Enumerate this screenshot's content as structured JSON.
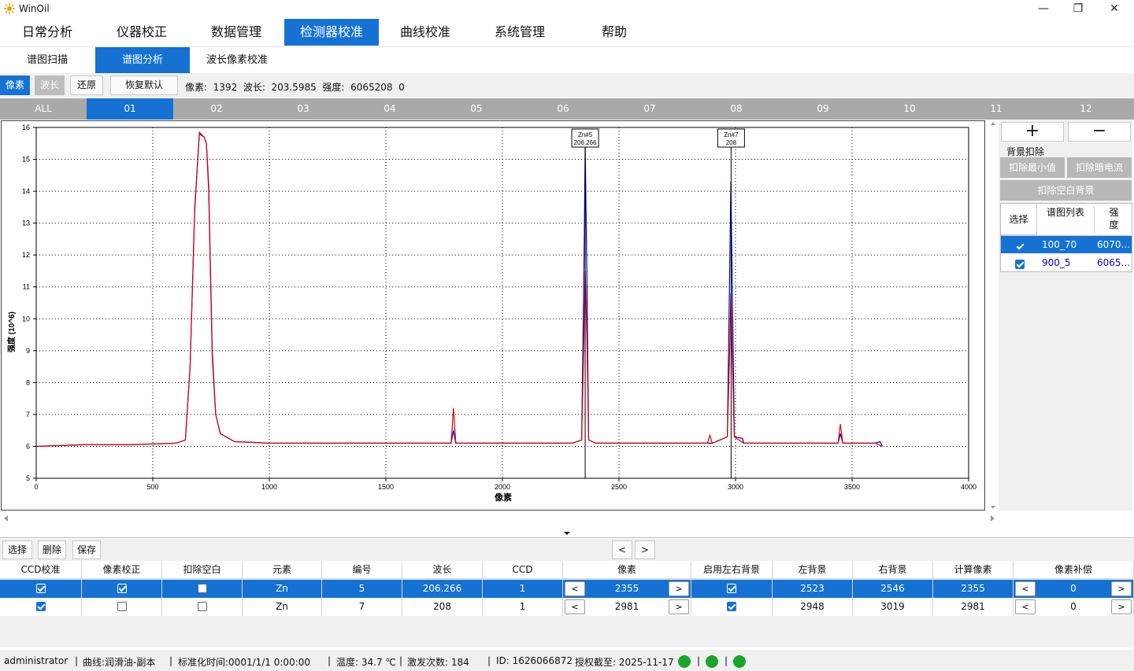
{
  "window": {
    "title": "WinOil",
    "min": "—",
    "max": "❐",
    "close": "✕"
  },
  "menu": {
    "tabs": [
      "日常分析",
      "仪器校正",
      "数据管理",
      "检测器校准",
      "曲线校准",
      "系统管理",
      "帮助"
    ],
    "active": 3
  },
  "submenu": {
    "tabs": [
      "谱图扫描",
      "谱图分析",
      "波长像素校准"
    ],
    "active": 1
  },
  "toolbar": {
    "pixel_toggle": "像素",
    "wavelength_toggle": "波长",
    "restore": "还原",
    "reset_default": "恢复默认",
    "readout": "像素:  1392  波长:  203.5985  强度:  6065208  0"
  },
  "channel_tabs": {
    "labels": [
      "ALL",
      "01",
      "02",
      "03",
      "04",
      "05",
      "06",
      "07",
      "08",
      "09",
      "10",
      "11",
      "12"
    ],
    "active": 1
  },
  "chart_data": {
    "type": "line",
    "xlabel": "像素",
    "ylabel": "强度 (10^6)",
    "xlim": [
      0,
      4000
    ],
    "ylim": [
      5,
      16
    ],
    "xticks": [
      0,
      500,
      1000,
      1500,
      2000,
      2500,
      3000,
      3500,
      4000
    ],
    "yticks": [
      5,
      6,
      7,
      8,
      9,
      10,
      11,
      12,
      13,
      14,
      15,
      16
    ],
    "grid": true,
    "markers": [
      {
        "label": "Zn#5",
        "value": "206.266",
        "x": 2355
      },
      {
        "label": "Zn#7",
        "value": "208",
        "x": 2981
      }
    ],
    "series": [
      {
        "color": "#0000cc",
        "points": [
          [
            0,
            6.0
          ],
          [
            200,
            6.05
          ],
          [
            400,
            6.05
          ],
          [
            600,
            6.1
          ],
          [
            640,
            6.2
          ],
          [
            660,
            8.5
          ],
          [
            680,
            13.5
          ],
          [
            700,
            15.8
          ],
          [
            720,
            15.7
          ],
          [
            730,
            15.5
          ],
          [
            740,
            14.2
          ],
          [
            755,
            9.0
          ],
          [
            770,
            7.0
          ],
          [
            790,
            6.4
          ],
          [
            850,
            6.15
          ],
          [
            1000,
            6.1
          ],
          [
            1500,
            6.1
          ],
          [
            1780,
            6.1
          ],
          [
            1790,
            6.5
          ],
          [
            1800,
            6.1
          ],
          [
            2300,
            6.1
          ],
          [
            2340,
            6.2
          ],
          [
            2350,
            11.7
          ],
          [
            2355,
            15.4
          ],
          [
            2362,
            11.5
          ],
          [
            2370,
            6.2
          ],
          [
            2400,
            6.1
          ],
          [
            2900,
            6.1
          ],
          [
            2965,
            6.3
          ],
          [
            2975,
            11.5
          ],
          [
            2980,
            14.3
          ],
          [
            2985,
            11.5
          ],
          [
            2995,
            6.3
          ],
          [
            3030,
            6.25
          ],
          [
            3035,
            6.1
          ],
          [
            3400,
            6.1
          ],
          [
            3440,
            6.1
          ],
          [
            3450,
            6.4
          ],
          [
            3460,
            6.1
          ],
          [
            3600,
            6.1
          ],
          [
            3620,
            6.15
          ],
          [
            3630,
            6.0
          ]
        ]
      },
      {
        "color": "#dd0000",
        "points": [
          [
            0,
            6.0
          ],
          [
            200,
            6.05
          ],
          [
            400,
            6.05
          ],
          [
            600,
            6.1
          ],
          [
            640,
            6.2
          ],
          [
            660,
            8.5
          ],
          [
            680,
            13.4
          ],
          [
            700,
            15.85
          ],
          [
            720,
            15.7
          ],
          [
            730,
            15.5
          ],
          [
            740,
            14.0
          ],
          [
            755,
            8.8
          ],
          [
            770,
            7.0
          ],
          [
            790,
            6.4
          ],
          [
            850,
            6.15
          ],
          [
            1000,
            6.1
          ],
          [
            1500,
            6.1
          ],
          [
            1780,
            6.1
          ],
          [
            1790,
            7.2
          ],
          [
            1800,
            6.1
          ],
          [
            2300,
            6.1
          ],
          [
            2340,
            6.2
          ],
          [
            2350,
            9.5
          ],
          [
            2355,
            11.5
          ],
          [
            2362,
            9.5
          ],
          [
            2370,
            6.2
          ],
          [
            2400,
            6.1
          ],
          [
            2880,
            6.1
          ],
          [
            2890,
            6.35
          ],
          [
            2900,
            6.1
          ],
          [
            2965,
            6.3
          ],
          [
            2975,
            9.0
          ],
          [
            2980,
            10.8
          ],
          [
            2985,
            9.0
          ],
          [
            2995,
            6.3
          ],
          [
            3035,
            6.1
          ],
          [
            3440,
            6.1
          ],
          [
            3450,
            6.7
          ],
          [
            3460,
            6.1
          ],
          [
            3600,
            6.1
          ],
          [
            3630,
            6.0
          ]
        ]
      }
    ]
  },
  "right_panel": {
    "plus": "+",
    "minus": "−",
    "section": "背景扣除",
    "btn_min": "扣除最小值",
    "btn_dark": "扣除暗电流",
    "btn_blank": "扣除空白背景",
    "grid_headers": [
      "选择",
      "谱图列表",
      "强度"
    ],
    "grid_rows": [
      {
        "checked": true,
        "name": "100_70",
        "value": "6070..."
      },
      {
        "checked": true,
        "name": "900_5",
        "value": "6065..."
      }
    ]
  },
  "bottom_toolbar": {
    "select": "选择",
    "delete": "删除",
    "save": "保存",
    "prev": "<",
    "next": ">"
  },
  "table": {
    "headers": [
      "CCD校准",
      "像素校正",
      "扣除空白",
      "元素",
      "编号",
      "波长",
      "CCD",
      "像素",
      "启用左右背景",
      "左背景",
      "右背景",
      "计算像素",
      "像素补偿"
    ],
    "rows": [
      {
        "ccd_cal": true,
        "px_corr": true,
        "blank": false,
        "element": "Zn",
        "num": "5",
        "wl": "206.266",
        "ccd": "1",
        "pixel": "2355",
        "lr_bg": true,
        "left_bg": "2523",
        "right_bg": "2546",
        "calc_px": "2355",
        "px_comp": "0"
      },
      {
        "ccd_cal": true,
        "px_corr": false,
        "blank": false,
        "element": "Zn",
        "num": "7",
        "wl": "208",
        "ccd": "1",
        "pixel": "2981",
        "lr_bg": true,
        "left_bg": "2948",
        "right_bg": "3019",
        "calc_px": "2981",
        "px_comp": "0"
      }
    ]
  },
  "status": {
    "user": "administrator",
    "curve": "曲线:润滑油-副本",
    "std_time": "标准化时间:0001/1/1 0:00:00",
    "temp": "温度: 34.7 ℃",
    "fire_count": "激发次数:  184",
    "id": "ID: 1626066872",
    "license": "授权截至: 2025-11-17",
    "led_color": "#1aa52a"
  }
}
